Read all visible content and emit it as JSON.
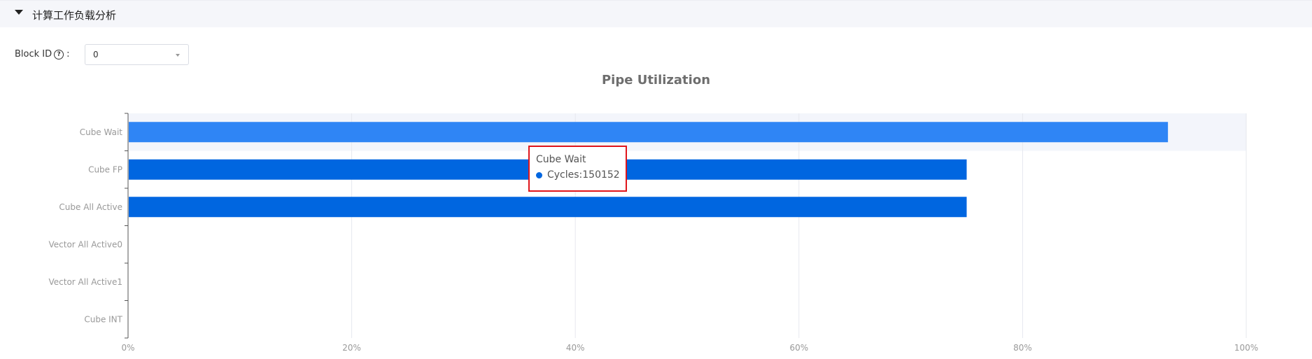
{
  "section": {
    "title": "计算工作负载分析"
  },
  "filter": {
    "label": "Block ID",
    "colon": ":",
    "help_icon": "question-circle-icon",
    "value": "0"
  },
  "chart_data": {
    "type": "bar",
    "orientation": "horizontal",
    "title": "Pipe Utilization",
    "categories": [
      "Cube Wait",
      "Cube FP",
      "Cube All Active",
      "Vector All Active0",
      "Vector All Active1",
      "Cube INT"
    ],
    "values": [
      93,
      75,
      75,
      0,
      0,
      0
    ],
    "xlim": [
      0,
      100
    ],
    "x_ticks": [
      "0%",
      "20%",
      "40%",
      "60%",
      "80%",
      "100%"
    ],
    "highlighted": "Cube Wait",
    "colors": {
      "bar": "#0066e0",
      "bar_hover": "#2f85f5",
      "hover_band": "#f3f5fb",
      "grid": "#e6e8ee",
      "axis": "#555555"
    },
    "grid": true
  },
  "tooltip": {
    "title": "Cube Wait",
    "label": "Cycles:150152",
    "marker_color": "#0066e0"
  }
}
